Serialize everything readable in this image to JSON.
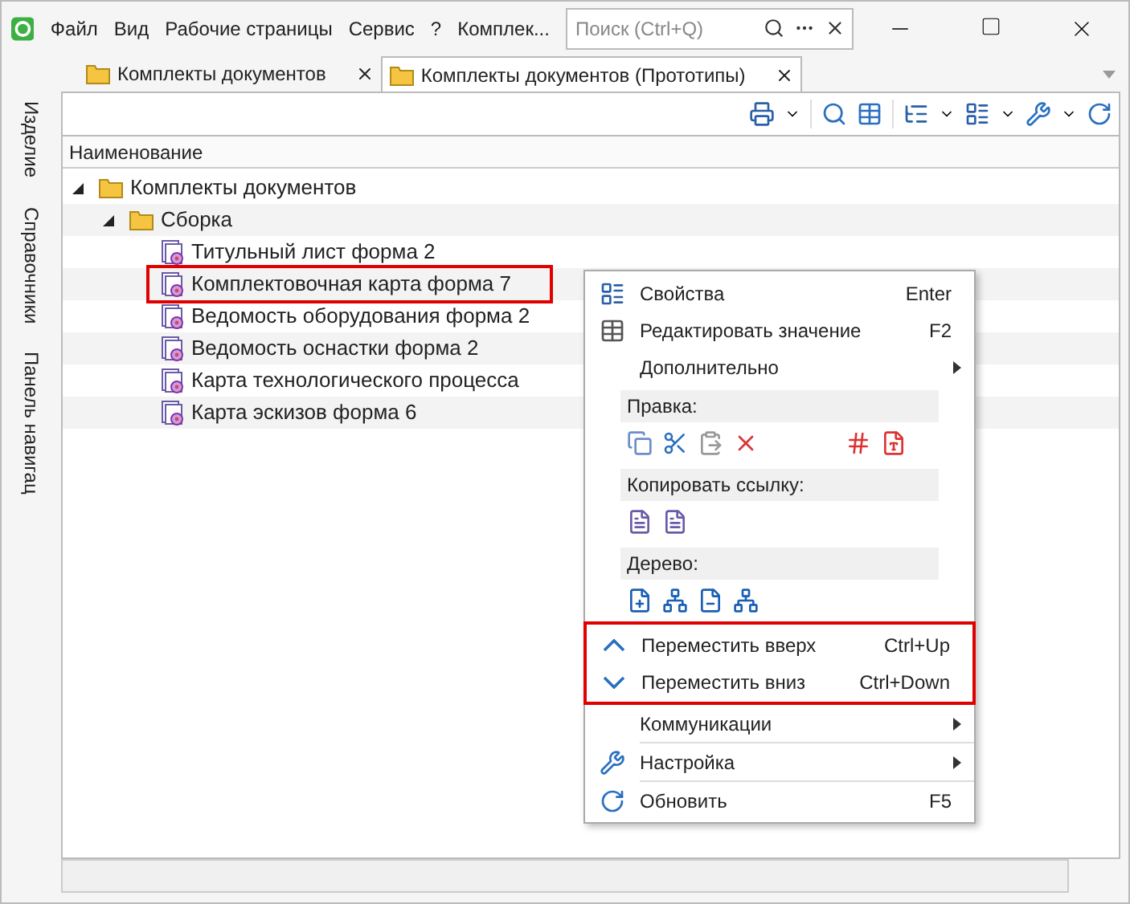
{
  "menu_bar": [
    "Файл",
    "Вид",
    "Рабочие страницы",
    "Сервис",
    "?",
    "Комплек..."
  ],
  "search": {
    "placeholder": "Поиск (Ctrl+Q)"
  },
  "tabs": [
    {
      "label": "Комплекты документов",
      "selected": false
    },
    {
      "label": "Комплекты документов (Прототипы)",
      "selected": true
    }
  ],
  "side_tabs": [
    "Изделие",
    "Справочники",
    "Панель навигац"
  ],
  "column": "Наименование",
  "tree": [
    {
      "label": "Комплекты документов",
      "expanded": true,
      "highlighted": false,
      "children": [
        {
          "label": "Сборка",
          "expanded": true,
          "highlighted": false,
          "children": [
            {
              "label": "Титульный лист форма 2",
              "highlighted": false
            },
            {
              "label": "Комплектовочная карта форма 7",
              "highlighted": true
            },
            {
              "label": "Ведомость оборудования форма 2",
              "highlighted": false
            },
            {
              "label": "Ведомость оснастки форма 2",
              "highlighted": false
            },
            {
              "label": "Карта технологического процесса",
              "highlighted": false
            },
            {
              "label": "Карта эскизов форма 6",
              "highlighted": false
            }
          ]
        }
      ]
    }
  ],
  "context_menu": [
    {
      "kind": "item",
      "label": "Свойства",
      "shortcut": "Enter",
      "submenu": false,
      "highlighted": false
    },
    {
      "kind": "item",
      "label": "Редактировать значение",
      "shortcut": "F2",
      "submenu": false,
      "highlighted": false
    },
    {
      "kind": "item",
      "label": "Дополнительно",
      "submenu": true,
      "highlighted": false
    },
    {
      "kind": "section",
      "label": "Правка:"
    },
    {
      "kind": "section",
      "label": "Копировать ссылку:"
    },
    {
      "kind": "section",
      "label": "Дерево:"
    },
    {
      "kind": "item",
      "label": "Переместить вверх",
      "shortcut": "Ctrl+Up",
      "submenu": false,
      "highlighted": true
    },
    {
      "kind": "item",
      "label": "Переместить вниз",
      "shortcut": "Ctrl+Down",
      "submenu": false,
      "highlighted": true
    },
    {
      "kind": "item",
      "label": "Коммуникации",
      "submenu": true,
      "highlighted": false
    },
    {
      "kind": "item",
      "label": "Настройка",
      "submenu": true,
      "highlighted": false
    },
    {
      "kind": "item",
      "label": "Обновить",
      "shortcut": "F5",
      "submenu": false,
      "highlighted": false
    }
  ]
}
